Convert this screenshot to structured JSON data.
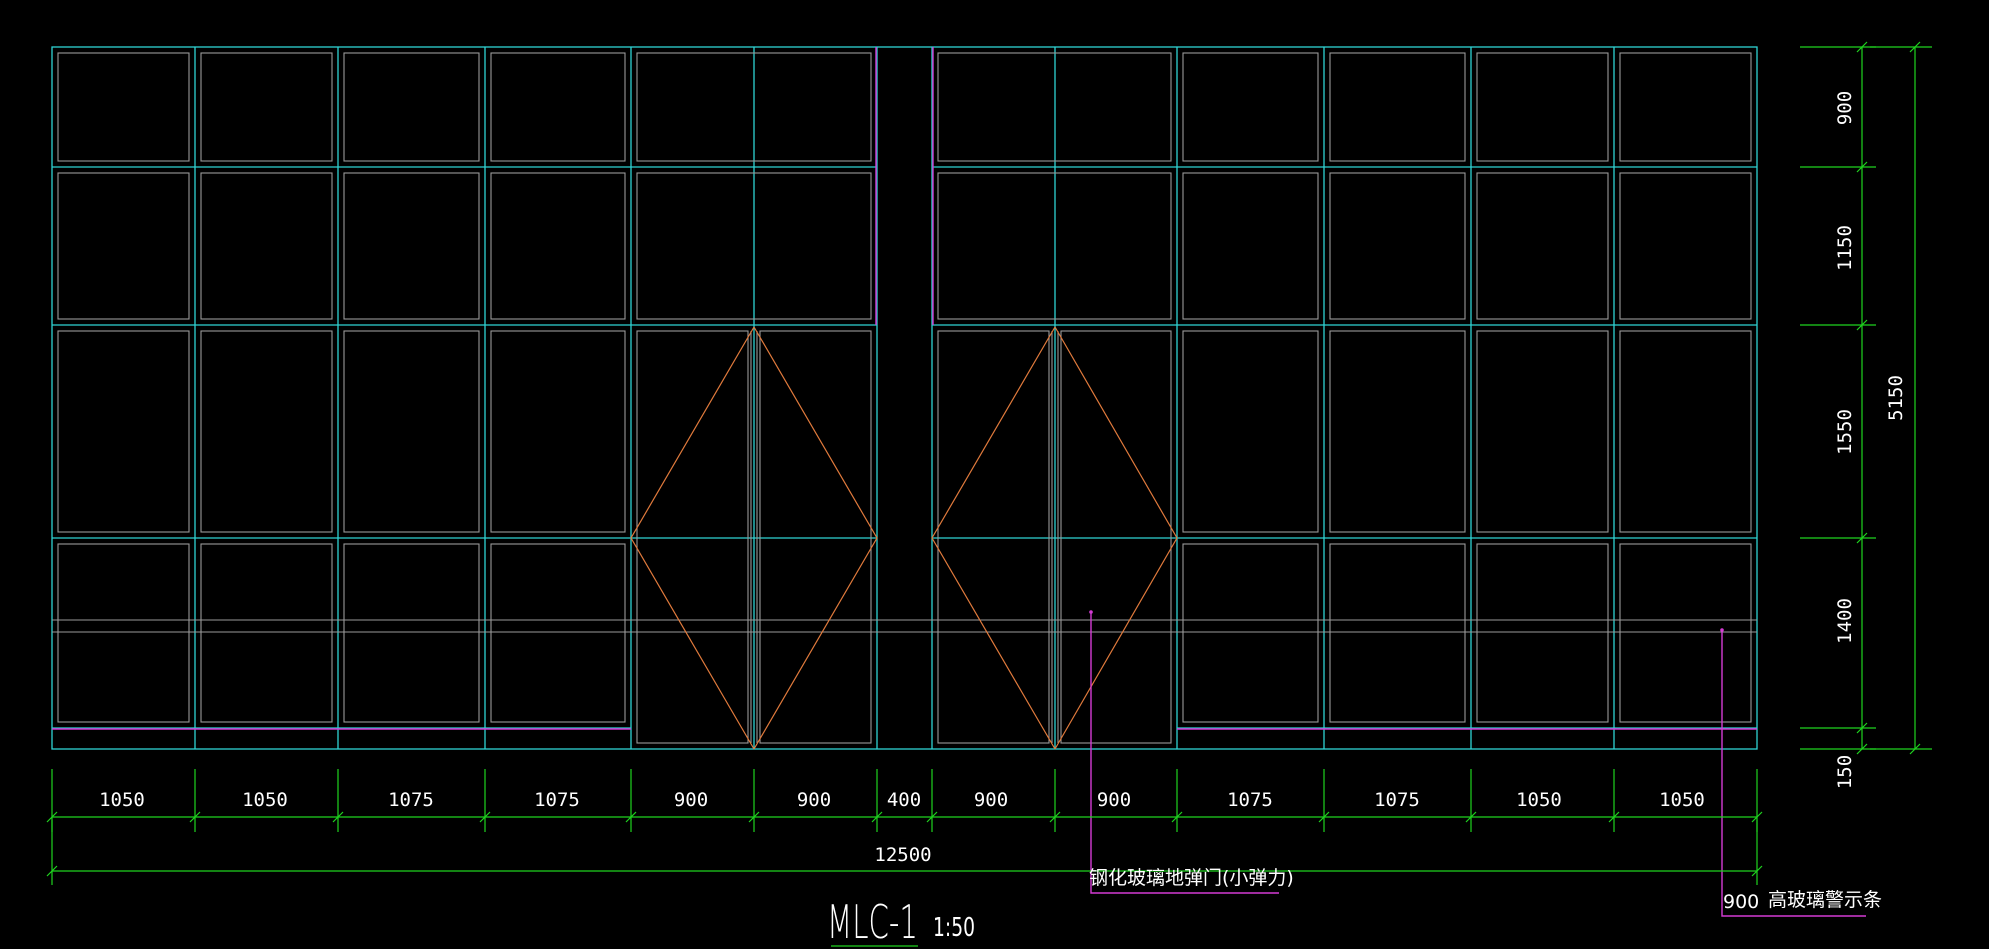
{
  "drawing": {
    "title": "MLC-1",
    "scale": "1:50",
    "colors": {
      "background": "#000000",
      "frame": "#2fd3d3",
      "glass": "#9a9a9a",
      "door_swing": "#e07a3c",
      "dimension": "#1fd41f",
      "leader": "#d43bd4",
      "text": "#ffffff"
    }
  },
  "horizontal_dimensions": {
    "segments": [
      "1050",
      "1050",
      "1075",
      "1075",
      "900",
      "900",
      "400",
      "900",
      "900",
      "1075",
      "1075",
      "1050",
      "1050"
    ],
    "total": "12500"
  },
  "vertical_dimensions": {
    "segments": [
      "900",
      "1150",
      "1550",
      "1400",
      "150"
    ],
    "total": "5150"
  },
  "annotations": {
    "door_note": "钢化玻璃地弹门(小弹力)",
    "glass_note_prefix": "900",
    "glass_note": "高玻璃警示条"
  }
}
